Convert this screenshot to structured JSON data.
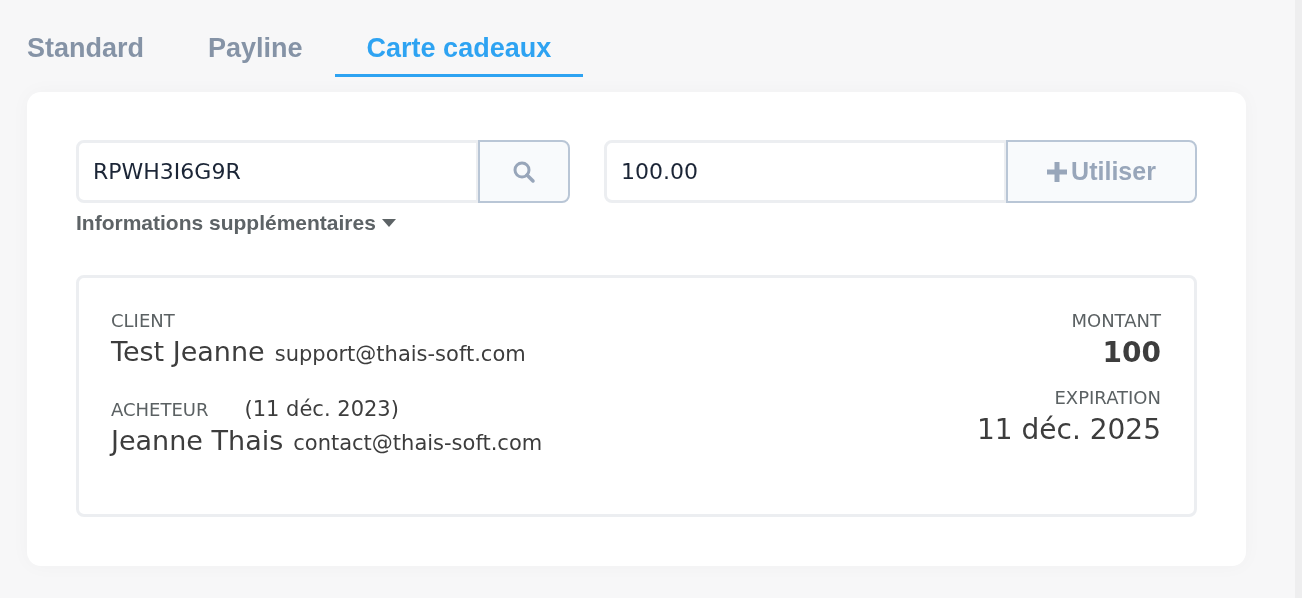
{
  "tabs": [
    {
      "label": "Standard",
      "selected": false
    },
    {
      "label": "Payline",
      "selected": false
    },
    {
      "label": "Carte cadeaux",
      "selected": true
    }
  ],
  "code_field": {
    "value": "RPWH3I6G9R"
  },
  "amount_field": {
    "value": "100.00"
  },
  "use_button": {
    "label": "Utiliser"
  },
  "more_info": {
    "label": "Informations supplémentaires",
    "expanded": false
  },
  "details": {
    "client": {
      "label": "CLIENT",
      "name": "Test Jeanne",
      "email": "support@thais-soft.com"
    },
    "buyer": {
      "label": "ACHETEUR",
      "date": "(11 déc. 2023)",
      "name": "Jeanne Thais",
      "email": "contact@thais-soft.com"
    },
    "amount": {
      "label": "MONTANT",
      "value": "100"
    },
    "expiration": {
      "label": "EXPIRATION",
      "value": "11 déc. 2025"
    }
  }
}
